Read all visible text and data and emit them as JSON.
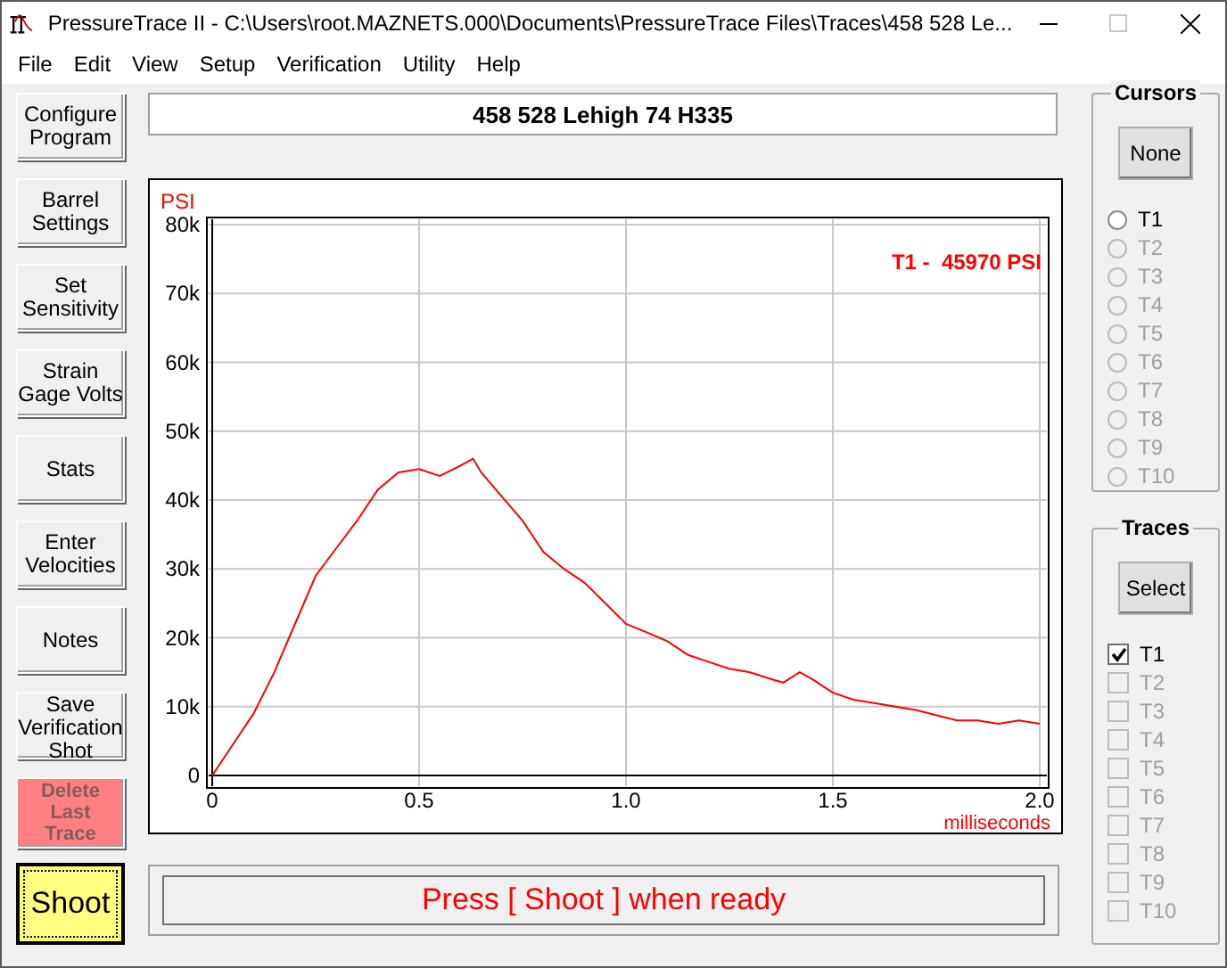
{
  "window": {
    "title": "PressureTrace II  -  C:\\Users\\root.MAZNETS.000\\Documents\\PressureTrace Files\\Traces\\458 528 Le..."
  },
  "menu": [
    "File",
    "Edit",
    "View",
    "Setup",
    "Verification",
    "Utility",
    "Help"
  ],
  "side_buttons": [
    {
      "label": "Configure Program",
      "kind": "normal",
      "disabled": false
    },
    {
      "label": "Barrel Settings",
      "kind": "normal",
      "disabled": false
    },
    {
      "label": "Set Sensitivity",
      "kind": "normal",
      "disabled": false
    },
    {
      "label": "Strain Gage Volts",
      "kind": "normal",
      "disabled": false
    },
    {
      "label": "Stats",
      "kind": "normal",
      "disabled": false
    },
    {
      "label": "Enter Velocities",
      "kind": "normal",
      "disabled": false
    },
    {
      "label": "Notes",
      "kind": "normal",
      "disabled": false
    },
    {
      "label": "Save Verification Shot",
      "kind": "normal",
      "disabled": false
    },
    {
      "label": "Delete Last Trace",
      "kind": "danger",
      "disabled": true
    },
    {
      "label": "Shoot",
      "kind": "shoot",
      "disabled": false
    }
  ],
  "trace_title": "458 528 Lehigh 74 H335",
  "chart_data": {
    "type": "line",
    "xlabel": "milliseconds",
    "ylabel": "PSI",
    "x": [
      0,
      0.05,
      0.1,
      0.15,
      0.2,
      0.25,
      0.3,
      0.35,
      0.4,
      0.45,
      0.5,
      0.55,
      0.6,
      0.63,
      0.65,
      0.7,
      0.75,
      0.8,
      0.85,
      0.9,
      0.95,
      1.0,
      1.05,
      1.1,
      1.15,
      1.2,
      1.25,
      1.3,
      1.35,
      1.38,
      1.42,
      1.45,
      1.5,
      1.55,
      1.6,
      1.7,
      1.8,
      1.85,
      1.9,
      1.95,
      2.0
    ],
    "grid": true,
    "series": [
      {
        "color": "#ff0000",
        "values": [
          0,
          4500,
          9000,
          15000,
          22000,
          29000,
          33000,
          37000,
          41500,
          44000,
          44500,
          43500,
          45000,
          46000,
          44000,
          40500,
          37000,
          32500,
          30000,
          28000,
          25000,
          22000,
          20800,
          19500,
          17500,
          16500,
          15500,
          15000,
          14000,
          13500,
          15000,
          14000,
          12000,
          11000,
          10500,
          9500,
          8000,
          8000,
          7500,
          8000,
          7500
        ]
      }
    ],
    "xlim": [
      0,
      2
    ],
    "ylim": [
      0,
      80000
    ],
    "xticks": [
      {
        "value": 0,
        "label": "0"
      },
      {
        "value": 0.5,
        "label": "0.5"
      },
      {
        "value": 1,
        "label": "1.0"
      },
      {
        "value": 1.5,
        "label": "1.5"
      },
      {
        "value": 2,
        "label": "2.0"
      }
    ],
    "yticks": [
      {
        "value": 0,
        "label": "0"
      },
      {
        "value": 10000,
        "label": "10k"
      },
      {
        "value": 20000,
        "label": "20k"
      },
      {
        "value": 30000,
        "label": "30k"
      },
      {
        "value": 40000,
        "label": "40k"
      },
      {
        "value": 50000,
        "label": "50k"
      },
      {
        "value": 60000,
        "label": "60k"
      },
      {
        "value": 70000,
        "label": "70k"
      },
      {
        "value": 80000,
        "label": "80k"
      }
    ],
    "annotations": [
      "T1 -  45970 PSI"
    ]
  },
  "status": "Press [ Shoot ] when ready",
  "cursors": {
    "title": "Cursors",
    "button": "None",
    "items": [
      {
        "label": "T1",
        "selected": false,
        "disabled": false
      },
      {
        "label": "T2",
        "selected": false,
        "disabled": true
      },
      {
        "label": "T3",
        "selected": false,
        "disabled": true
      },
      {
        "label": "T4",
        "selected": false,
        "disabled": true
      },
      {
        "label": "T5",
        "selected": false,
        "disabled": true
      },
      {
        "label": "T6",
        "selected": false,
        "disabled": true
      },
      {
        "label": "T7",
        "selected": false,
        "disabled": true
      },
      {
        "label": "T8",
        "selected": false,
        "disabled": true
      },
      {
        "label": "T9",
        "selected": false,
        "disabled": true
      },
      {
        "label": "T10",
        "selected": false,
        "disabled": true
      }
    ]
  },
  "traces": {
    "title": "Traces",
    "button": "Select",
    "items": [
      {
        "label": "T1",
        "checked": true,
        "disabled": false
      },
      {
        "label": "T2",
        "checked": false,
        "disabled": true
      },
      {
        "label": "T3",
        "checked": false,
        "disabled": true
      },
      {
        "label": "T4",
        "checked": false,
        "disabled": true
      },
      {
        "label": "T5",
        "checked": false,
        "disabled": true
      },
      {
        "label": "T6",
        "checked": false,
        "disabled": true
      },
      {
        "label": "T7",
        "checked": false,
        "disabled": true
      },
      {
        "label": "T8",
        "checked": false,
        "disabled": true
      },
      {
        "label": "T9",
        "checked": false,
        "disabled": true
      },
      {
        "label": "T10",
        "checked": false,
        "disabled": true
      }
    ]
  }
}
